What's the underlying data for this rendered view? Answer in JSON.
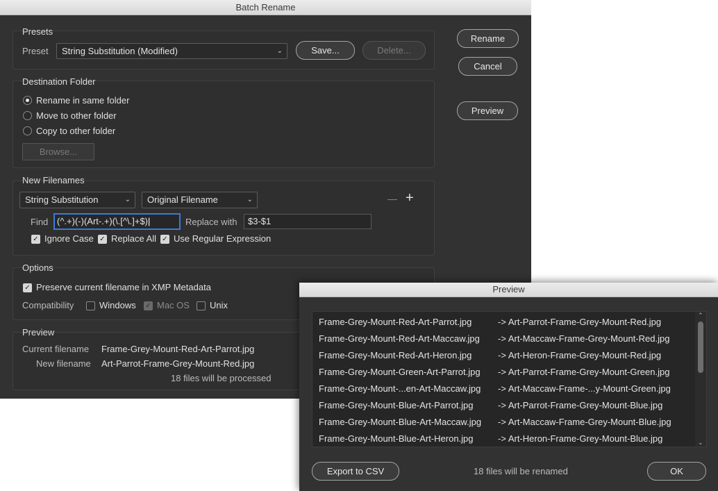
{
  "main": {
    "title": "Batch Rename",
    "presets": {
      "group_label": "Presets",
      "preset_label": "Preset",
      "preset_value": "String Substitution (Modified)",
      "save_label": "Save...",
      "delete_label": "Delete..."
    },
    "buttons": {
      "rename": "Rename",
      "cancel": "Cancel",
      "preview": "Preview"
    },
    "destination": {
      "group_label": "Destination Folder",
      "option_same": "Rename in same folder",
      "option_move": "Move to other folder",
      "option_copy": "Copy to other folder",
      "browse_label": "Browse..."
    },
    "new_filenames": {
      "group_label": "New Filenames",
      "type_value": "String Substitution",
      "field_value": "Original Filename",
      "minus": "—",
      "plus": "+",
      "find_label": "Find",
      "find_value": "(^.+)(-)(Art-.+)(\\.[^\\.]+$)",
      "replace_label": "Replace with",
      "replace_value": "$3-$1",
      "ignore_case": "Ignore Case",
      "replace_all": "Replace All",
      "use_regex": "Use Regular Expression"
    },
    "options": {
      "group_label": "Options",
      "preserve": "Preserve current filename in XMP Metadata",
      "compat_label": "Compatibility",
      "windows": "Windows",
      "macos": "Mac OS",
      "unix": "Unix"
    },
    "preview": {
      "group_label": "Preview",
      "current_label": "Current filename",
      "current_value": "Frame-Grey-Mount-Red-Art-Parrot.jpg",
      "new_label": "New filename",
      "new_value": "Art-Parrot-Frame-Grey-Mount-Red.jpg",
      "count_text": "18 files will be processed"
    }
  },
  "preview_dialog": {
    "title": "Preview",
    "rows": [
      {
        "from": "Frame-Grey-Mount-Red-Art-Parrot.jpg",
        "to": "-> Art-Parrot-Frame-Grey-Mount-Red.jpg"
      },
      {
        "from": "Frame-Grey-Mount-Red-Art-Maccaw.jpg",
        "to": "-> Art-Maccaw-Frame-Grey-Mount-Red.jpg"
      },
      {
        "from": "Frame-Grey-Mount-Red-Art-Heron.jpg",
        "to": "-> Art-Heron-Frame-Grey-Mount-Red.jpg"
      },
      {
        "from": "Frame-Grey-Mount-Green-Art-Parrot.jpg",
        "to": "-> Art-Parrot-Frame-Grey-Mount-Green.jpg"
      },
      {
        "from": "Frame-Grey-Mount-...en-Art-Maccaw.jpg",
        "to": "-> Art-Maccaw-Frame-...y-Mount-Green.jpg"
      },
      {
        "from": "Frame-Grey-Mount-Blue-Art-Parrot.jpg",
        "to": "-> Art-Parrot-Frame-Grey-Mount-Blue.jpg"
      },
      {
        "from": "Frame-Grey-Mount-Blue-Art-Maccaw.jpg",
        "to": "-> Art-Maccaw-Frame-Grey-Mount-Blue.jpg"
      },
      {
        "from": "Frame-Grey-Mount-Blue-Art-Heron.jpg",
        "to": "-> Art-Heron-Frame-Grey-Mount-Blue.jpg"
      }
    ],
    "export_label": "Export to CSV",
    "count_text": "18 files will be renamed",
    "ok_label": "OK"
  },
  "colors": {
    "dialog_bg": "#323232",
    "focus_ring": "#3a7bd5"
  }
}
